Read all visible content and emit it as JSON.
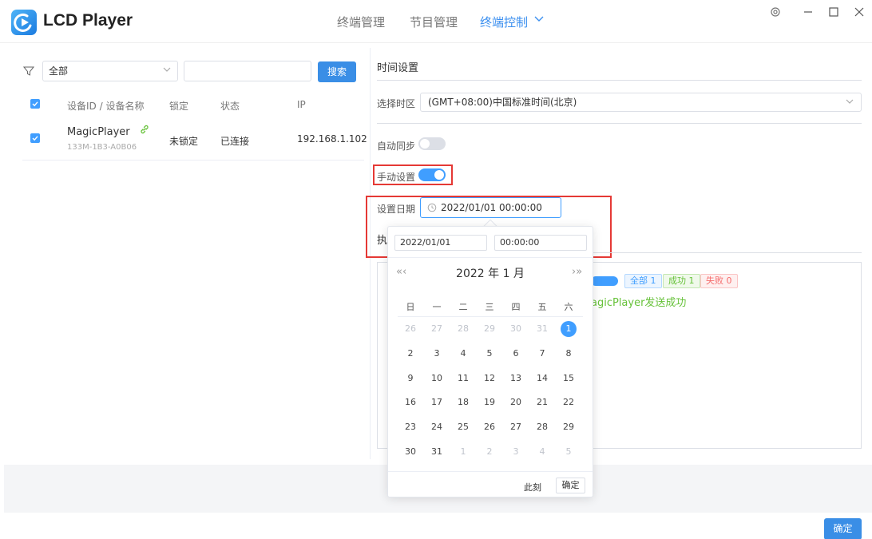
{
  "header": {
    "app_title": "LCD Player",
    "nav": [
      {
        "label": "终端管理",
        "active": false
      },
      {
        "label": "节目管理",
        "active": false
      },
      {
        "label": "终端控制",
        "active": true
      }
    ],
    "window_controls": [
      "settings-icon",
      "minimize-icon",
      "maximize-icon",
      "close-icon"
    ]
  },
  "filter": {
    "select_value": "全部",
    "search_value": "",
    "search_button": "搜索"
  },
  "device_table": {
    "columns": [
      "设备ID / 设备名称",
      "锁定",
      "状态",
      "IP"
    ],
    "rows": [
      {
        "name": "MagicPlayer",
        "id": "133M-1B3-A0B06",
        "lock": "未锁定",
        "status": "已连接",
        "ip": "192.168.1.102",
        "checked": true
      }
    ]
  },
  "time_settings": {
    "section_title": "时间设置",
    "timezone_label": "选择时区",
    "timezone_value": "(GMT+08:00)中国标准时间(北京)",
    "auto_sync_label": "自动同步",
    "auto_sync_on": false,
    "manual_label": "手动设置",
    "manual_on": true,
    "date_label": "设置日期",
    "date_value": "2022/01/01 00:00:00",
    "exec_label_partial": "执"
  },
  "result": {
    "tag_all": "全部 1",
    "tag_success": "成功 1",
    "tag_fail": "失败 0",
    "log_line": "agicPlayer发送成功"
  },
  "date_picker": {
    "date_input": "2022/01/01",
    "time_input": "00:00:00",
    "prev_nav": "«‹",
    "next_nav": "›»",
    "title": "2022 年  1 月",
    "weekdays": [
      "日",
      "一",
      "二",
      "三",
      "四",
      "五",
      "六"
    ],
    "weeks": [
      [
        "26",
        "27",
        "28",
        "29",
        "30",
        "31",
        "1"
      ],
      [
        "2",
        "3",
        "4",
        "5",
        "6",
        "7",
        "8"
      ],
      [
        "9",
        "10",
        "11",
        "12",
        "13",
        "14",
        "15"
      ],
      [
        "16",
        "17",
        "18",
        "19",
        "20",
        "21",
        "22"
      ],
      [
        "23",
        "24",
        "25",
        "26",
        "27",
        "28",
        "29"
      ],
      [
        "30",
        "31",
        "1",
        "2",
        "3",
        "4",
        "5"
      ]
    ],
    "selected_day": "1",
    "now_button": "此刻",
    "ok_button": "确定"
  },
  "footer": {
    "ok_button": "确定"
  },
  "colors": {
    "accent": "#409eff",
    "highlight_box": "#e53935",
    "success": "#67c23a",
    "danger": "#f56c6c"
  }
}
